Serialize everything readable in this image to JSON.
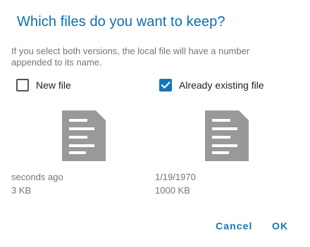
{
  "dialog": {
    "title": "Which files do you want to keep?",
    "description": "If you select both versions, the local file will have a number appended to its name."
  },
  "options": {
    "new_file": {
      "label": "New file",
      "checked": false
    },
    "existing_file": {
      "label": "Already existing file",
      "checked": true
    }
  },
  "files": {
    "new": {
      "icon": "document-icon",
      "time": "seconds ago",
      "size": "3 KB"
    },
    "existing": {
      "icon": "document-icon",
      "time": "1/19/1970",
      "size": "1000 KB"
    }
  },
  "actions": {
    "cancel_label": "Cancel",
    "ok_label": "OK"
  },
  "colors": {
    "accent": "#1674b9",
    "title": "#0a6fb0",
    "icon": "#999999",
    "muted_text": "#757575"
  }
}
